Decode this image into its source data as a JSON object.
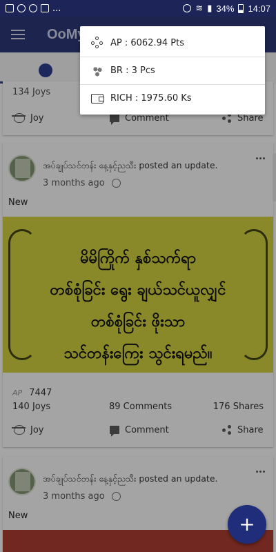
{
  "status_bar": {
    "battery": "34%",
    "time": "14:07",
    "notif_more": "..."
  },
  "app_bar": {
    "title": "OoMy"
  },
  "popup": {
    "items": [
      {
        "label": "AP : 6062.94 Pts",
        "icon": "network-icon"
      },
      {
        "label": "BR : 3 Pcs",
        "icon": "gems-icon"
      },
      {
        "label": "RICH : 1975.60 Ks",
        "icon": "wallet-icon"
      }
    ]
  },
  "card1": {
    "joys": "134 Joys",
    "joy": "Joy",
    "comment": "Comment",
    "share": "Share"
  },
  "card2": {
    "author": "အပ်ချုပ်သင်တန်း နေ့နှင့်ညသီး",
    "posted": "posted an update.",
    "time": "3 months ago",
    "text": "New",
    "banner_lines": [
      "မိမိကြိုက် နှစ်သက်ရာ",
      "တစ်စုံခြင်း ရွေး ချယ်သင်ယူလျှင်",
      "တစ်စုံခြင်း ဖိုးသာ",
      "သင်တန်းကြေး သွင်းရမည်။"
    ],
    "ap_mark": "AP",
    "ap_value": "7447",
    "joys": "140 Joys",
    "comments": "89 Comments",
    "shares": "176 Shares",
    "joy": "Joy",
    "comment": "Comment",
    "share": "Share"
  },
  "card3": {
    "author": "အပ်ချုပ်သင်တန်း နေ့နှင့်ညသီး",
    "posted": "posted an update.",
    "time": "3 months ago",
    "text": "New"
  },
  "fab": {
    "label": "+"
  },
  "colors": {
    "primary": "#2a3470",
    "fab": "#1f2d7a",
    "banner": "#c4c43b"
  }
}
